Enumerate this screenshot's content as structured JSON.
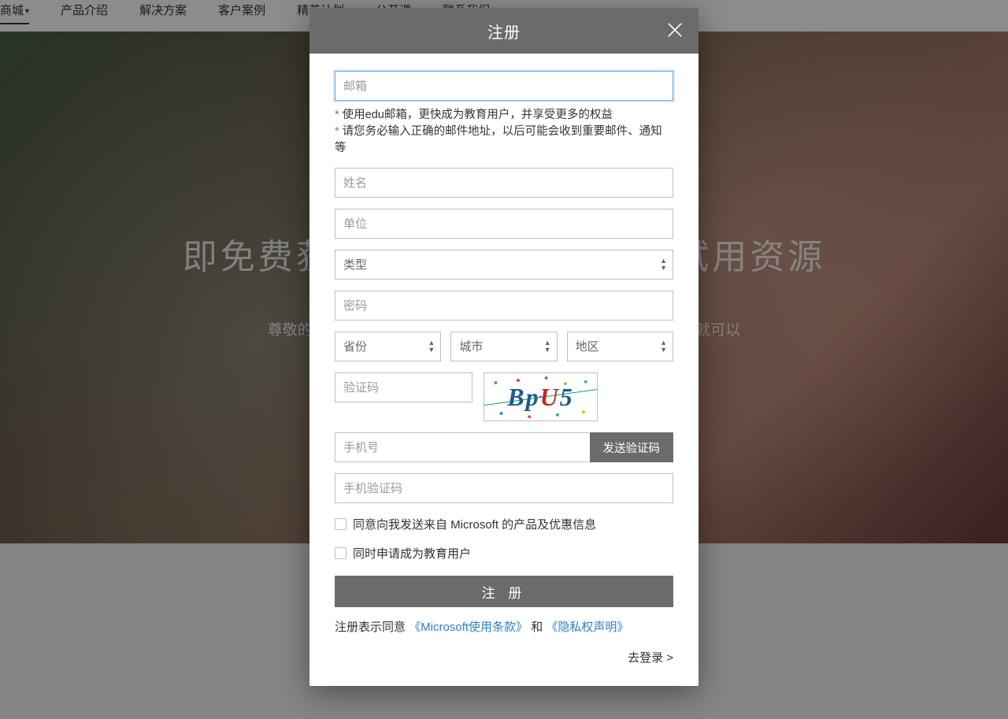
{
  "nav": {
    "items": [
      {
        "label": "商城",
        "active": true,
        "dropdown": true
      },
      {
        "label": "产品介绍"
      },
      {
        "label": "解决方案"
      },
      {
        "label": "客户案例"
      },
      {
        "label": "精英计划"
      },
      {
        "label": "公开课"
      },
      {
        "label": "联系我们"
      }
    ]
  },
  "hero": {
    "title_left": "即免费获",
    "title_right": "试用资源",
    "subtitle_left": "尊敬的教育",
    "subtitle_right": "申请就可以"
  },
  "modal": {
    "title": "注册",
    "email_placeholder": "邮箱",
    "hint1": "使用edu邮箱，更快成为教育用户，并享受更多的权益",
    "hint2": "请您务必输入正确的邮件地址，以后可能会收到重要邮件、通知等",
    "name_placeholder": "姓名",
    "org_placeholder": "单位",
    "type_placeholder": "类型",
    "password_placeholder": "密码",
    "province_placeholder": "省份",
    "city_placeholder": "城市",
    "district_placeholder": "地区",
    "captcha_placeholder": "验证码",
    "captcha_value": "BpU5",
    "phone_placeholder": "手机号",
    "send_code": "发送验证码",
    "phone_code_placeholder": "手机验证码",
    "consent_marketing": "同意向我发送来自 Microsoft 的产品及优惠信息",
    "consent_edu": "同时申请成为教育用户",
    "register_btn": "注 册",
    "terms_pre": "注册表示同意",
    "terms_link1": "《Microsoft使用条款》",
    "terms_and": "和",
    "terms_link2": "《隐私权声明》",
    "login_link": "去登录 >"
  }
}
